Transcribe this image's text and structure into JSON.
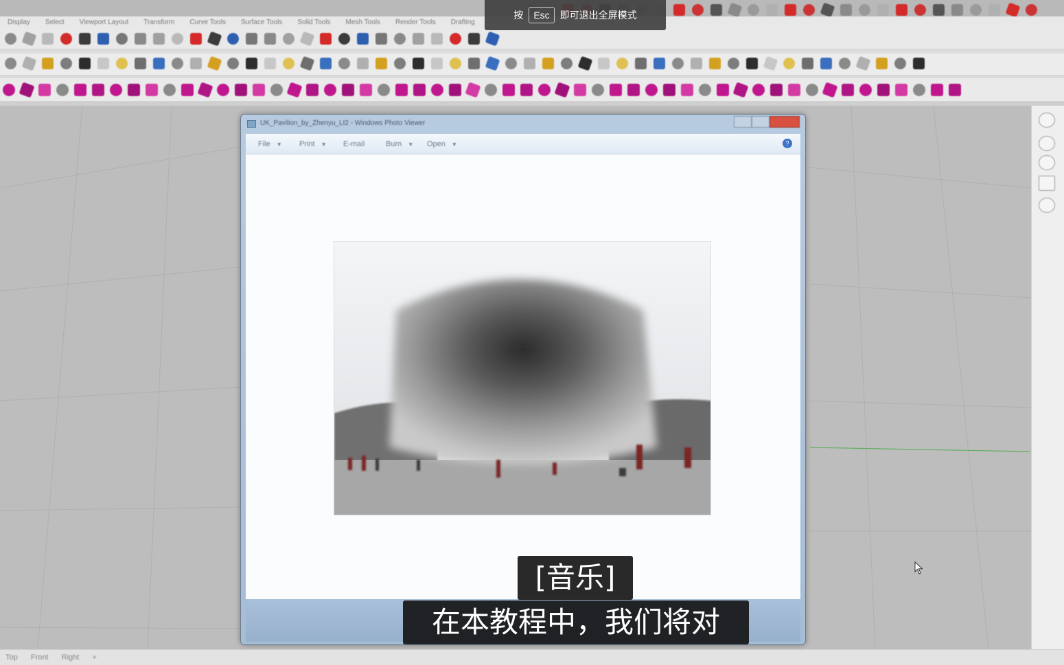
{
  "fullscreen_hint": {
    "press": "按",
    "key": "Esc",
    "message": "即可退出全屏模式"
  },
  "rhino": {
    "menu": [
      "Display",
      "Select",
      "Viewport Layout",
      "Transform",
      "Curve Tools",
      "Surface Tools",
      "Solid Tools",
      "Mesh Tools",
      "Render Tools",
      "Drafting"
    ],
    "viewport_tabs": [
      "Top",
      "Front",
      "Right",
      "+"
    ]
  },
  "photo_viewer": {
    "title": "UK_Pavilion_by_Zhenyu_LI2 - Windows Photo Viewer",
    "commands": [
      {
        "label": "File",
        "has_arrow": true
      },
      {
        "label": "Print",
        "has_arrow": true
      },
      {
        "label": "E-mail",
        "has_arrow": false
      },
      {
        "label": "Burn",
        "has_arrow": true
      },
      {
        "label": "Open",
        "has_arrow": true
      }
    ],
    "help_glyph": "?"
  },
  "subtitles": {
    "line1": "[音乐]",
    "line2": "在本教程中，我们将对"
  },
  "colors": {
    "magenta_icons": "#c0168e",
    "red_icons": "#d42a2a",
    "viewport_bg": "#bdbdbd",
    "viewer_frame": "#a6bdd6"
  }
}
